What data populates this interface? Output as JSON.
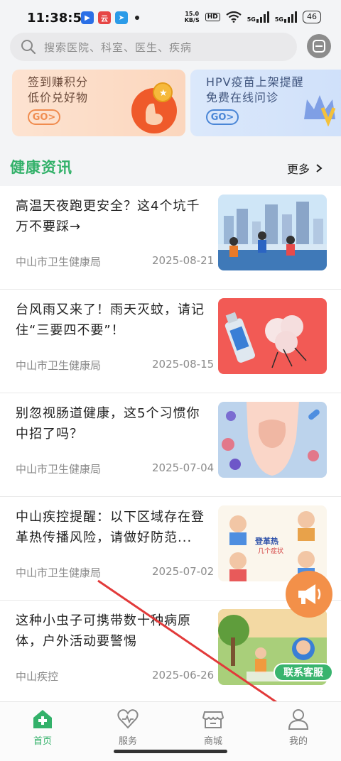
{
  "status_bar": {
    "time": "11:38:52",
    "net_speed_value": "15.0",
    "net_speed_unit": "KB/S",
    "hd_label": "HD",
    "signal_1": "5G",
    "signal_2": "5G",
    "battery": "46"
  },
  "search": {
    "placeholder": "搜索医院、科室、医生、疾病"
  },
  "banners": [
    {
      "line1": "签到赚积分",
      "line2": "低价兑好物",
      "button": "GO>"
    },
    {
      "line1": "HPV疫苗上架提醒",
      "line2": "免费在线问诊",
      "button": "GO>"
    }
  ],
  "news_section": {
    "title": "健康资讯",
    "more_label": "更多"
  },
  "news": [
    {
      "title": "高温天夜跑更安全？这4个坑千万不要踩→",
      "source": "中山市卫生健康局",
      "date": "2025-08-21"
    },
    {
      "title": "台风雨又来了！雨天灭蚊，请记住“三要四不要”！",
      "source": "中山市卫生健康局",
      "date": "2025-08-15"
    },
    {
      "title": "别忽视肠道健康，这5个习惯你中招了吗？",
      "source": "中山市卫生健康局",
      "date": "2025-07-04"
    },
    {
      "title": "中山疾控提醒：以下区域存在登革热传播风险，请做好防范...",
      "source": "中山市卫生健康局",
      "date": "2025-07-02"
    },
    {
      "title": "这种小虫子可携带数十种病原体，户外活动要警惕",
      "source": "中山疾控",
      "date": "2025-06-26"
    }
  ],
  "thumb_texts": {
    "dengue_1": "登革热",
    "dengue_2": "几个症状"
  },
  "floating": {
    "service_label": "联系客服"
  },
  "tabbar": [
    {
      "label": "首页",
      "icon": "home-icon",
      "active": true
    },
    {
      "label": "服务",
      "icon": "heart-icon",
      "active": false
    },
    {
      "label": "商城",
      "icon": "store-icon",
      "active": false
    },
    {
      "label": "我的",
      "icon": "profile-icon",
      "active": false
    }
  ],
  "colors": {
    "accent_green": "#33b16a",
    "annotation_arrow": "#e23a3a"
  }
}
